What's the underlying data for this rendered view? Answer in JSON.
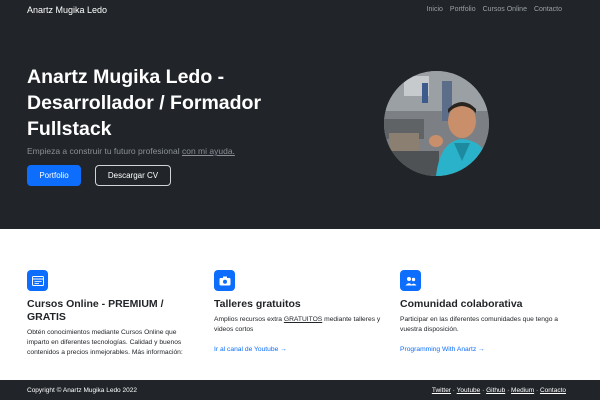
{
  "navbar": {
    "brand": "Anartz Mugika Ledo",
    "links": [
      "Inicio",
      "Portfolio",
      "Cursos Online",
      "Contacto"
    ]
  },
  "hero": {
    "title": "Anartz Mugika Ledo - Desarrollador / Formador Fullstack",
    "lead_text": "Empieza a construir tu futuro profesional",
    "lead_link": "con mi ayuda.",
    "primary_button": "Portfolio",
    "secondary_button": "Descargar CV"
  },
  "features": [
    {
      "icon": "browser-window-icon",
      "title": "Cursos Online - PREMIUM / GRATIS",
      "text": "Obtén conocimientos mediante Cursos Online que imparto en diferentes tecnologías. Calidad y buenos contenidos a precios inmejorables. Más información:",
      "link": ""
    },
    {
      "icon": "camera-icon",
      "title": "Talleres gratuitos",
      "text_before": "Amplios recursos extra",
      "text_emph": "GRATUITOS",
      "text_after": "mediante talleres y videos cortos",
      "link": "Ir al canal de Youtube →"
    },
    {
      "icon": "people-icon",
      "title": "Comunidad colaborativa",
      "text": "Participar en las diferentes comunidades que tengo a vuestra disposición.",
      "link": "Programming With Anartz →"
    }
  ],
  "footer": {
    "copyright": "Copyright © Anartz Mugika Ledo 2022",
    "links": [
      "Twitter",
      "Youtube",
      "Github",
      "Medium",
      "Contacto"
    ],
    "separator": "·"
  },
  "colors": {
    "dark": "#212529",
    "primary": "#0d6efd"
  }
}
